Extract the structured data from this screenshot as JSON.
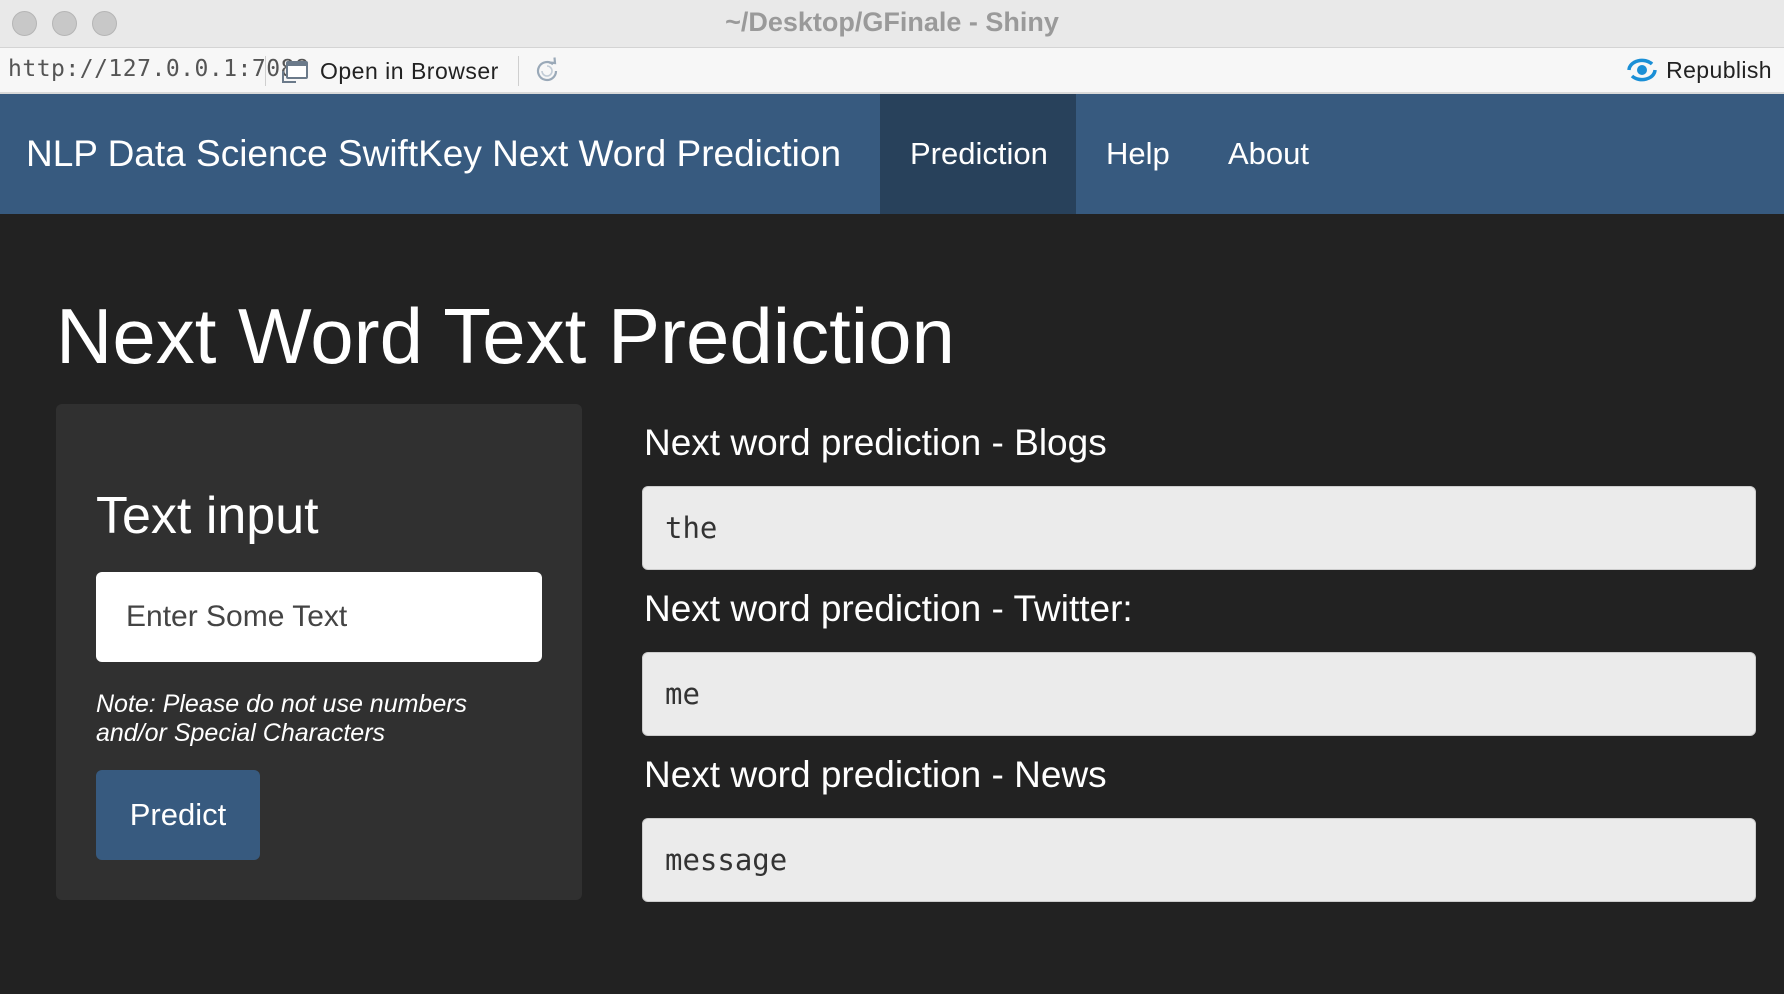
{
  "window": {
    "title": "~/Desktop/GFinale - Shiny"
  },
  "toolbar": {
    "url": "http://127.0.0.1:7088",
    "open_in_browser_label": "Open in Browser",
    "republish_label": "Republish"
  },
  "navbar": {
    "brand": "NLP Data Science SwiftKey Next Word Prediction",
    "tabs": [
      {
        "label": "Prediction",
        "active": true
      },
      {
        "label": "Help",
        "active": false
      },
      {
        "label": "About",
        "active": false
      }
    ]
  },
  "main": {
    "page_title": "Next Word Text Prediction",
    "sidebar": {
      "title": "Text input",
      "input_placeholder": "Enter Some Text",
      "input_value": "",
      "note": "Note: Please do not use numbers and/or Special Characters",
      "predict_button": "Predict"
    },
    "outputs": [
      {
        "label": "Next word prediction - Blogs",
        "value": "the"
      },
      {
        "label": "Next word prediction - Twitter:",
        "value": "me"
      },
      {
        "label": "Next word prediction - News",
        "value": "message"
      }
    ]
  },
  "colors": {
    "navbar": "#375a7f",
    "navbar_active": "#28415b",
    "background": "#222222",
    "well": "#303030",
    "output_box": "#ebebeb"
  }
}
